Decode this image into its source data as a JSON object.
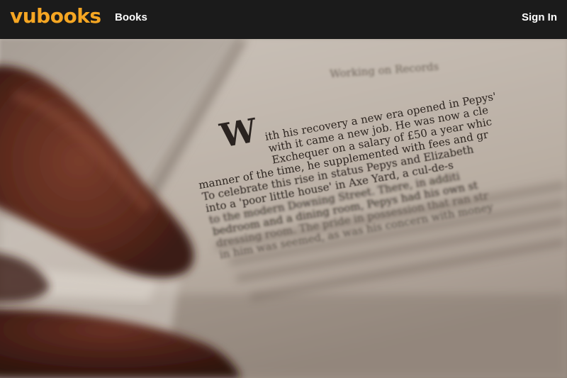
{
  "header": {
    "logo": "vubooks",
    "nav_books": "Books",
    "sign_in": "Sign In"
  },
  "colors": {
    "navbar_bg": "#1b1b1b",
    "logo": "#f5a623",
    "nav_text": "#ffffff"
  },
  "hero": {
    "image_description_icon": "open-book-photo",
    "book_heading": "Working on Records",
    "drop_cap": "W",
    "text_lines": [
      "ith his recovery a new era opened in Pepys'",
      "with it came a new job. He was now a cle",
      "Exchequer on a salary of £50 a year whic",
      "manner of the time, he supplemented with fees and gr",
      "To celebrate this rise in status Pepys and Elizabeth",
      "into a 'poor little house' in Axe Yard, a cul-de-s",
      "to the modern Downing Street. There, in additi",
      "bedroom and a dining room, Pepys had his own st",
      "dressing room. The pride in possession that ran str",
      "in him was seemed, as was his concern with money"
    ]
  }
}
